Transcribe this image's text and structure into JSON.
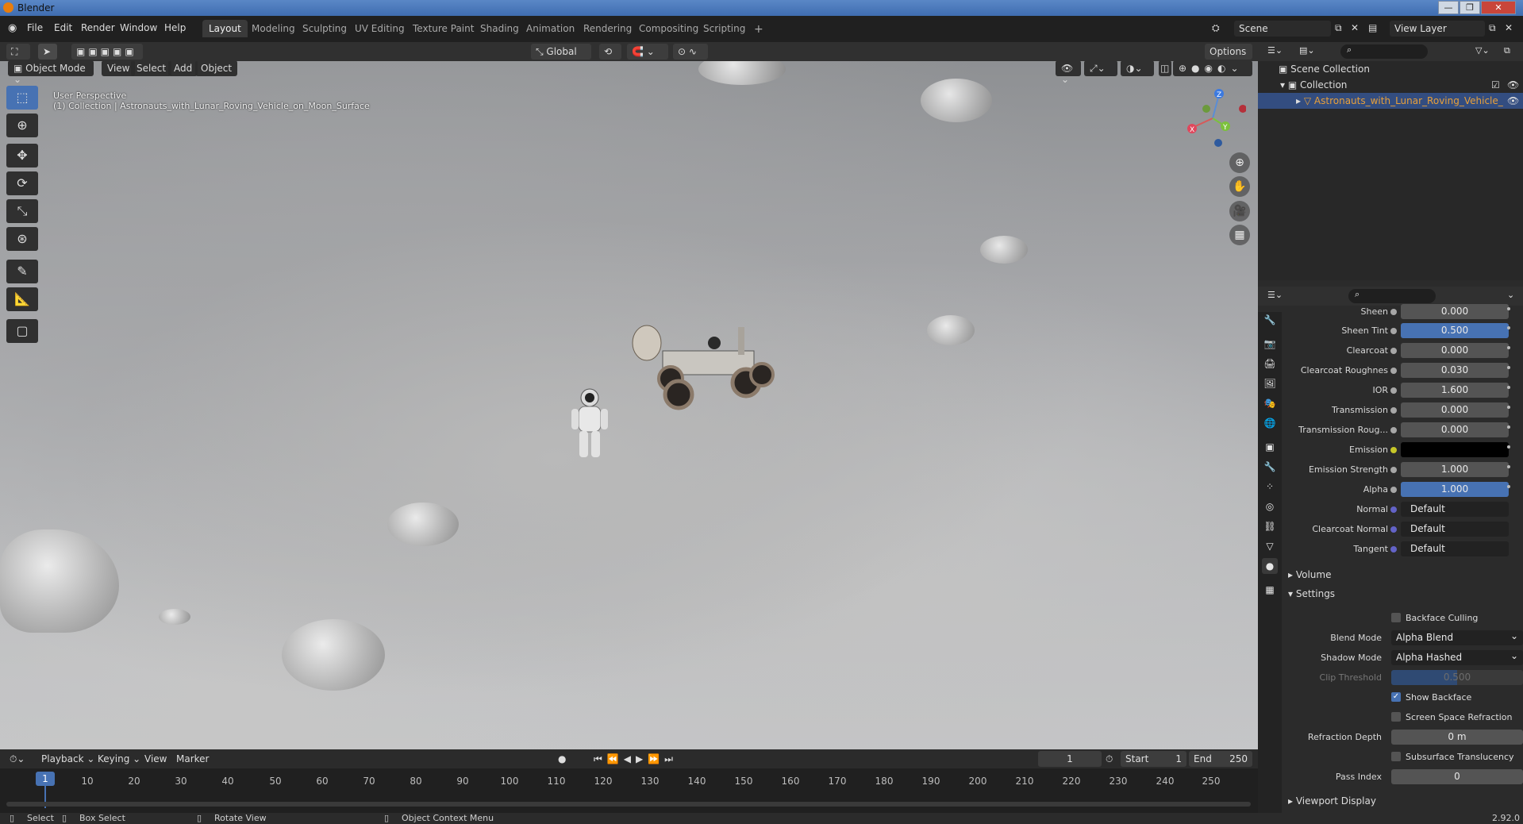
{
  "app": {
    "title": "Blender",
    "version": "2.92.0"
  },
  "menu": {
    "items": [
      "File",
      "Edit",
      "Render",
      "Window",
      "Help"
    ]
  },
  "workspaces": [
    "Layout",
    "Modeling",
    "Sculpting",
    "UV Editing",
    "Texture Paint",
    "Shading",
    "Animation",
    "Rendering",
    "Compositing",
    "Scripting"
  ],
  "scene": {
    "scene_name": "Scene",
    "view_layer": "View Layer"
  },
  "tool_header": {
    "orientation": "Global",
    "options": "Options"
  },
  "viewport": {
    "mode": "Object Mode",
    "menus": [
      "View",
      "Select",
      "Add",
      "Object"
    ],
    "perspective": "User Perspective",
    "collection_info": "(1) Collection | Astronauts_with_Lunar_Roving_Vehicle_on_Moon_Surface",
    "gizmo": {
      "x": "X",
      "y": "Y",
      "z": "Z"
    }
  },
  "timeline": {
    "menus": [
      "Playback",
      "Keying",
      "View",
      "Marker"
    ],
    "current_frame": "1",
    "start_label": "Start",
    "start": "1",
    "end_label": "End",
    "end": "250",
    "ticks": [
      "1",
      "10",
      "20",
      "30",
      "40",
      "50",
      "60",
      "70",
      "80",
      "90",
      "100",
      "110",
      "120",
      "130",
      "140",
      "150",
      "160",
      "170",
      "180",
      "190",
      "200",
      "210",
      "220",
      "230",
      "240",
      "250"
    ]
  },
  "statusbar": {
    "select": "Select",
    "box_select": "Box Select",
    "rotate_view": "Rotate View",
    "context_menu": "Object Context Menu"
  },
  "outliner": {
    "scene_collection": "Scene Collection",
    "collection": "Collection",
    "object": "Astronauts_with_Lunar_Roving_Vehicle_"
  },
  "properties": {
    "rows": [
      {
        "label": "Sheen",
        "value": "0.000",
        "type": "number"
      },
      {
        "label": "Sheen Tint",
        "value": "0.500",
        "type": "fill"
      },
      {
        "label": "Clearcoat",
        "value": "0.000",
        "type": "number"
      },
      {
        "label": "Clearcoat Roughnes",
        "value": "0.030",
        "type": "number"
      },
      {
        "label": "IOR",
        "value": "1.600",
        "type": "number"
      },
      {
        "label": "Transmission",
        "value": "0.000",
        "type": "number"
      },
      {
        "label": "Transmission Roug...",
        "value": "0.000",
        "type": "number"
      },
      {
        "label": "Emission",
        "value": "",
        "type": "color"
      },
      {
        "label": "Emission Strength",
        "value": "1.000",
        "type": "number"
      },
      {
        "label": "Alpha",
        "value": "1.000",
        "type": "fill"
      },
      {
        "label": "Normal",
        "value": "Default",
        "type": "socket"
      },
      {
        "label": "Clearcoat Normal",
        "value": "Default",
        "type": "socket"
      },
      {
        "label": "Tangent",
        "value": "Default",
        "type": "socket"
      }
    ],
    "sections": {
      "volume": "Volume",
      "settings": "Settings",
      "viewport_display": "Viewport Display"
    },
    "settings": {
      "backface_culling": "Backface Culling",
      "blend_mode_label": "Blend Mode",
      "blend_mode": "Alpha Blend",
      "shadow_mode_label": "Shadow Mode",
      "shadow_mode": "Alpha Hashed",
      "clip_threshold_label": "Clip Threshold",
      "clip_threshold": "0.500",
      "show_backface": "Show Backface",
      "ssr": "Screen Space Refraction",
      "refraction_depth_label": "Refraction Depth",
      "refraction_depth": "0 m",
      "sss_translucency": "Subsurface Translucency",
      "pass_index_label": "Pass Index",
      "pass_index": "0"
    }
  },
  "colors": {
    "accent": "#4772b3",
    "active_object": "#e8a03a"
  }
}
